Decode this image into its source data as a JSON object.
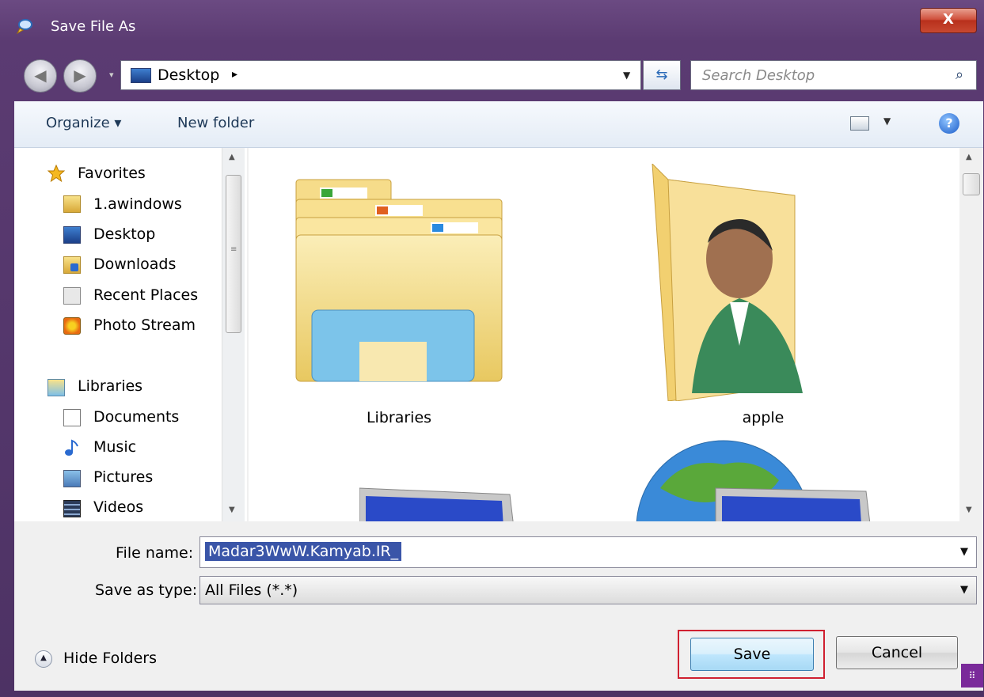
{
  "window": {
    "title": "Save File As",
    "close_label": "X"
  },
  "address_bar": {
    "location": "Desktop",
    "separator": "▸",
    "search_placeholder": "Search Desktop"
  },
  "toolbar": {
    "organize_label": "Organize ▾",
    "new_folder_label": "New folder"
  },
  "navigation": {
    "favorites_header": "Favorites",
    "favorites": [
      "1.awindows",
      "Desktop",
      "Downloads",
      "Recent Places",
      "Photo Stream"
    ],
    "libraries_header": "Libraries",
    "libraries": [
      "Documents",
      "Music",
      "Pictures",
      "Videos"
    ]
  },
  "content": {
    "items": [
      {
        "label": "Libraries",
        "icon": "libraries-folder-icon"
      },
      {
        "label": "apple",
        "icon": "user-folder-icon"
      },
      {
        "label": "",
        "icon": "computer-icon"
      },
      {
        "label": "",
        "icon": "network-icon"
      }
    ]
  },
  "form": {
    "file_name_label": "File name:",
    "file_name_value": "Madar3WwW.Kamyab.IR_",
    "save_type_label": "Save as type:",
    "save_type_value": "All Files (*.*)"
  },
  "footer": {
    "hide_folders_label": "Hide Folders",
    "save_label": "Save",
    "cancel_label": "Cancel"
  },
  "colors": {
    "highlight": "#d02030",
    "selection": "#3a55a8",
    "chrome": "#5b3b72"
  }
}
